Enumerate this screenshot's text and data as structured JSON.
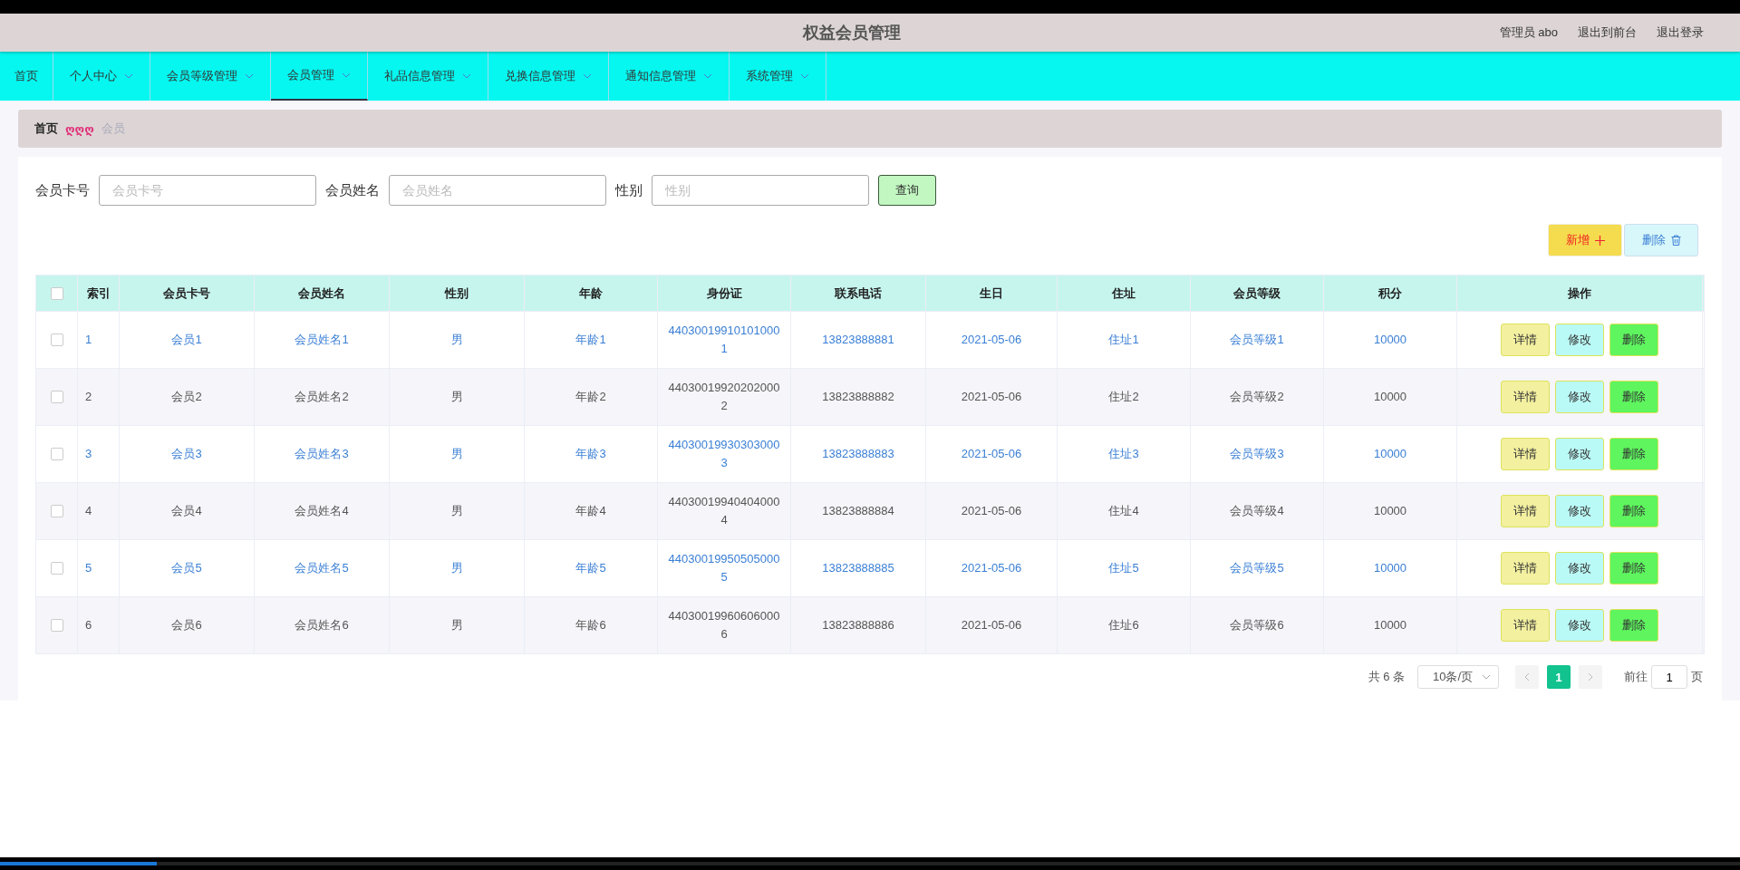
{
  "header": {
    "title": "权益会员管理",
    "user": "管理员 abo",
    "links": [
      "退出到前台",
      "退出登录"
    ]
  },
  "nav": [
    {
      "label": "首页",
      "dropdown": false,
      "selected": false
    },
    {
      "label": "个人中心",
      "dropdown": true,
      "selected": false
    },
    {
      "label": "会员等级管理",
      "dropdown": true,
      "selected": false
    },
    {
      "label": "会员管理",
      "dropdown": true,
      "selected": true
    },
    {
      "label": "礼品信息管理",
      "dropdown": true,
      "selected": false
    },
    {
      "label": "兑换信息管理",
      "dropdown": true,
      "selected": false
    },
    {
      "label": "通知信息管理",
      "dropdown": true,
      "selected": false
    },
    {
      "label": "系统管理",
      "dropdown": true,
      "selected": false
    }
  ],
  "breadcrumb": {
    "home": "首页",
    "separator": "ღღღ",
    "current": "会员"
  },
  "search": {
    "fields": [
      {
        "label": "会员卡号",
        "placeholder": "会员卡号"
      },
      {
        "label": "会员姓名",
        "placeholder": "会员姓名"
      },
      {
        "label": "性别",
        "placeholder": "性别"
      }
    ],
    "button": "查询"
  },
  "actions": {
    "add": "新增",
    "delete": "删除"
  },
  "table": {
    "select_all_checked": false,
    "columns": [
      "索引",
      "会员卡号",
      "会员姓名",
      "性别",
      "年龄",
      "身份证",
      "联系电话",
      "生日",
      "住址",
      "会员等级",
      "积分",
      "操作"
    ],
    "rows": [
      {
        "kind": "link",
        "checked": false,
        "cells": [
          "1",
          "会员1",
          "会员姓名1",
          "男",
          "年龄1",
          "440300199101010001",
          "13823888881",
          "2021-05-06",
          "住址1",
          "会员等级1",
          "10000"
        ],
        "buttons": [
          "详情",
          "修改",
          "删除"
        ]
      },
      {
        "kind": "plain",
        "checked": false,
        "cells": [
          "2",
          "会员2",
          "会员姓名2",
          "男",
          "年龄2",
          "440300199202020002",
          "13823888882",
          "2021-05-06",
          "住址2",
          "会员等级2",
          "10000"
        ],
        "buttons": [
          "详情",
          "修改",
          "删除"
        ]
      },
      {
        "kind": "link",
        "checked": false,
        "cells": [
          "3",
          "会员3",
          "会员姓名3",
          "男",
          "年龄3",
          "440300199303030003",
          "13823888883",
          "2021-05-06",
          "住址3",
          "会员等级3",
          "10000"
        ],
        "buttons": [
          "详情",
          "修改",
          "删除"
        ]
      },
      {
        "kind": "plain",
        "checked": false,
        "cells": [
          "4",
          "会员4",
          "会员姓名4",
          "男",
          "年龄4",
          "440300199404040004",
          "13823888884",
          "2021-05-06",
          "住址4",
          "会员等级4",
          "10000"
        ],
        "buttons": [
          "详情",
          "修改",
          "删除"
        ]
      },
      {
        "kind": "link",
        "checked": false,
        "cells": [
          "5",
          "会员5",
          "会员姓名5",
          "男",
          "年龄5",
          "440300199505050005",
          "13823888885",
          "2021-05-06",
          "住址5",
          "会员等级5",
          "10000"
        ],
        "buttons": [
          "详情",
          "修改",
          "删除"
        ]
      },
      {
        "kind": "plain",
        "checked": false,
        "cells": [
          "6",
          "会员6",
          "会员姓名6",
          "男",
          "年龄6",
          "440300199606060006",
          "13823888886",
          "2021-05-06",
          "住址6",
          "会员等级6",
          "10000"
        ],
        "buttons": [
          "详情",
          "修改",
          "删除"
        ]
      }
    ]
  },
  "pagination": {
    "total": "共 6 条",
    "page_size": "10条/页",
    "pages": [
      {
        "label": "1",
        "selected": true
      }
    ],
    "goto_label": "前往",
    "goto_value": "1",
    "goto_suffix": "页"
  },
  "player_bar": {
    "level": 0.09
  }
}
